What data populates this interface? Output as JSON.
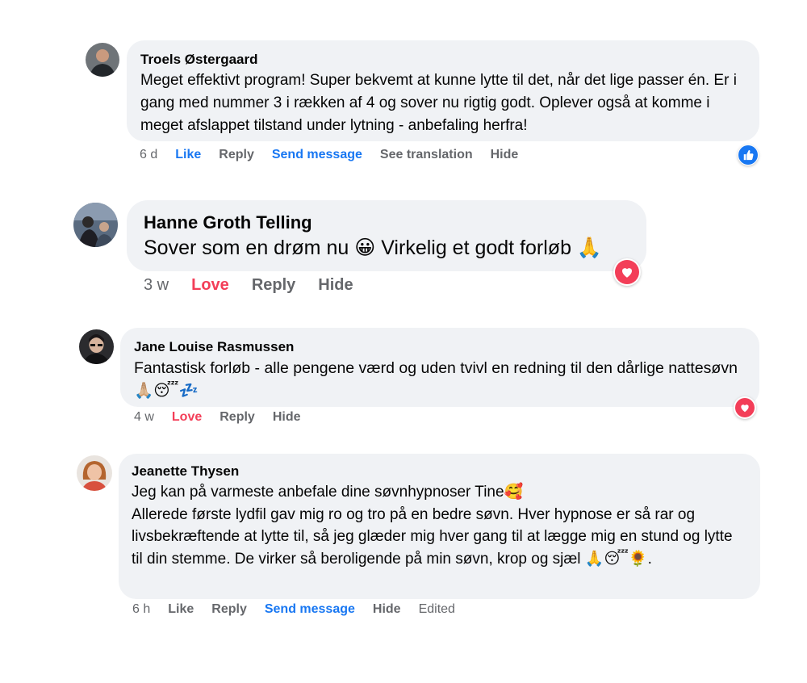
{
  "comments": [
    {
      "author": "Troels Østergaard",
      "text": "Meget effektivt program! Super bekvemt at kunne lytte til det, når det lige passer én. Er i gang med nummer 3 i rækken af 4 og sover nu rigtig godt. Oplever også at komme i meget afslappet tilstand under lytning - anbefaling herfra!",
      "time": "6 d",
      "like": "Like",
      "reply": "Reply",
      "send_message": "Send message",
      "see_translation": "See translation",
      "hide": "Hide",
      "reaction": "like"
    },
    {
      "author": "Hanne Groth Telling",
      "text": "Sover som en drøm nu 😀 Virkelig et godt forløb 🙏",
      "time": "3 w",
      "love": "Love",
      "reply": "Reply",
      "hide": "Hide",
      "reaction": "love"
    },
    {
      "author": "Jane Louise Rasmussen",
      "text": "Fantastisk forløb - alle pengene værd og uden tvivl en redning til den dårlige nattesøvn🙏🏼😴💤",
      "time": "4 w",
      "love": "Love",
      "reply": "Reply",
      "hide": "Hide",
      "reaction": "love"
    },
    {
      "author": "Jeanette Thysen",
      "text": "Jeg kan på varmeste anbefale dine søvnhypnoser Tine🥰\nAllerede første lydfil gav mig ro og tro på en bedre søvn. Hver hypnose er så rar og livsbekræftende at lytte til, så jeg glæder mig hver gang til at lægge mig en stund og lytte til din stemme. De virker så beroligende på min søvn, krop og sjæl 🙏😴🌻.",
      "time": "6 h",
      "like": "Like",
      "reply": "Reply",
      "send_message": "Send message",
      "hide": "Hide",
      "edited": "Edited"
    }
  ],
  "colors": {
    "bubble": "#f0f2f5",
    "link_blue": "#1877f2",
    "love_red": "#f33e58",
    "muted": "#65676b"
  }
}
